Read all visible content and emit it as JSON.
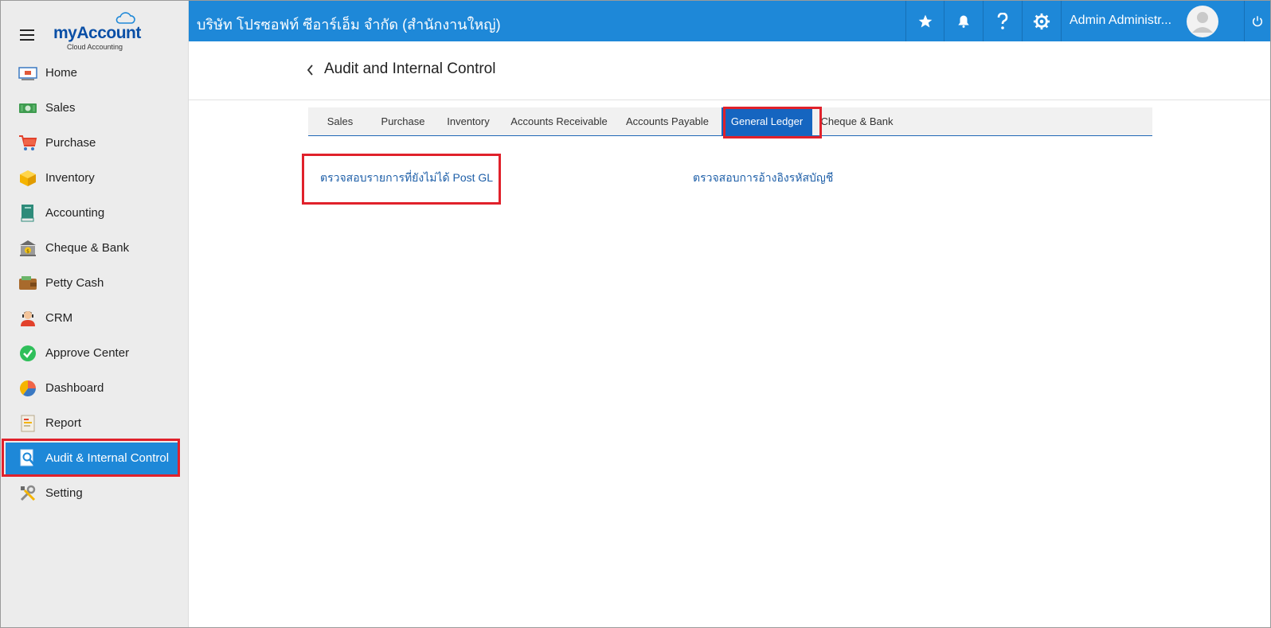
{
  "brand": {
    "logo_my": "my",
    "logo_account": "Account",
    "logo_sub": "Cloud Accounting"
  },
  "sidebar": {
    "items": [
      {
        "label": "Home",
        "icon": "home-icon"
      },
      {
        "label": "Sales",
        "icon": "sales-icon"
      },
      {
        "label": "Purchase",
        "icon": "cart-icon"
      },
      {
        "label": "Inventory",
        "icon": "box-icon"
      },
      {
        "label": "Accounting",
        "icon": "book-icon"
      },
      {
        "label": "Cheque & Bank",
        "icon": "bank-icon"
      },
      {
        "label": "Petty Cash",
        "icon": "wallet-icon"
      },
      {
        "label": "CRM",
        "icon": "person-icon"
      },
      {
        "label": "Approve Center",
        "icon": "check-icon"
      },
      {
        "label": "Dashboard",
        "icon": "pie-icon"
      },
      {
        "label": "Report",
        "icon": "report-icon"
      },
      {
        "label": "Audit & Internal Control",
        "icon": "audit-icon",
        "active": true
      },
      {
        "label": "Setting",
        "icon": "tools-icon"
      }
    ]
  },
  "topbar": {
    "company": "บริษัท โปรซอฟท์ ซีอาร์เอ็ม จำกัด (สำนักงานใหญ่)",
    "user_name": "Admin Administr...",
    "icons": [
      "star-icon",
      "bell-icon",
      "help-icon",
      "gear-icon",
      "avatar",
      "power-icon"
    ]
  },
  "page": {
    "title": "Audit and Internal Control"
  },
  "tabs": [
    {
      "label": "Sales"
    },
    {
      "label": "Purchase"
    },
    {
      "label": "Inventory"
    },
    {
      "label": "Accounts Receivable"
    },
    {
      "label": "Accounts Payable"
    },
    {
      "label": "General Ledger",
      "active": true
    },
    {
      "label": "Cheque & Bank"
    }
  ],
  "links": {
    "unposted_gl": "ตรวจสอบรายการที่ยังไม่ได้ Post GL",
    "account_reference": "ตรวจสอบการอ้างอิงรหัสบัญชี"
  },
  "colors": {
    "primary": "#1e88d8",
    "active_tab": "#1565c0",
    "highlight": "#e0212b",
    "link": "#1e5fa8"
  }
}
